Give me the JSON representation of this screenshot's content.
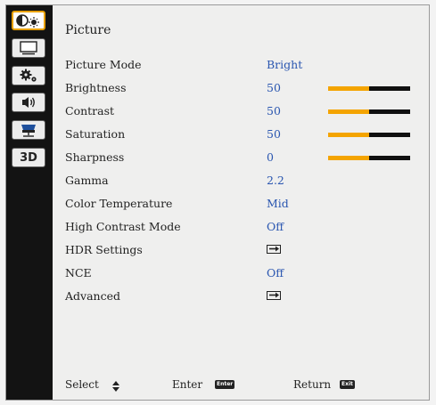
{
  "sidebar": {
    "items": [
      {
        "name": "picture",
        "icon": "picture-settings-icon",
        "active": true
      },
      {
        "name": "display",
        "icon": "display-screen-icon"
      },
      {
        "name": "setup",
        "icon": "setup-gears-icon"
      },
      {
        "name": "audio",
        "icon": "speaker-icon"
      },
      {
        "name": "options",
        "icon": "projector-options-icon"
      },
      {
        "name": "3d",
        "label": "3D"
      }
    ]
  },
  "menu": {
    "title": "Picture",
    "rows": [
      {
        "label": "Picture Mode",
        "value": "Bright"
      },
      {
        "label": "Brightness",
        "value": "50",
        "bar": 0.5
      },
      {
        "label": "Contrast",
        "value": "50",
        "bar": 0.5
      },
      {
        "label": "Saturation",
        "value": "50",
        "bar": 0.5
      },
      {
        "label": "Sharpness",
        "value": "0",
        "bar": 0.5
      },
      {
        "label": "Gamma",
        "value": "2.2"
      },
      {
        "label": "Color Temperature",
        "value": "Mid"
      },
      {
        "label": "High Contrast Mode",
        "value": "Off"
      },
      {
        "label": "HDR Settings",
        "value_icon": "submenu-arrow-icon"
      },
      {
        "label": "NCE",
        "value": "Off"
      },
      {
        "label": "Advanced",
        "value_icon": "submenu-arrow-icon"
      }
    ]
  },
  "footer": {
    "select_label": "Select",
    "enter_label": "Enter",
    "enter_key": "Enter",
    "return_label": "Return",
    "return_key": "Exit"
  },
  "colors": {
    "accent": "#f4a400",
    "value_text": "#2a56b0",
    "sidebar_bg": "#131313"
  }
}
